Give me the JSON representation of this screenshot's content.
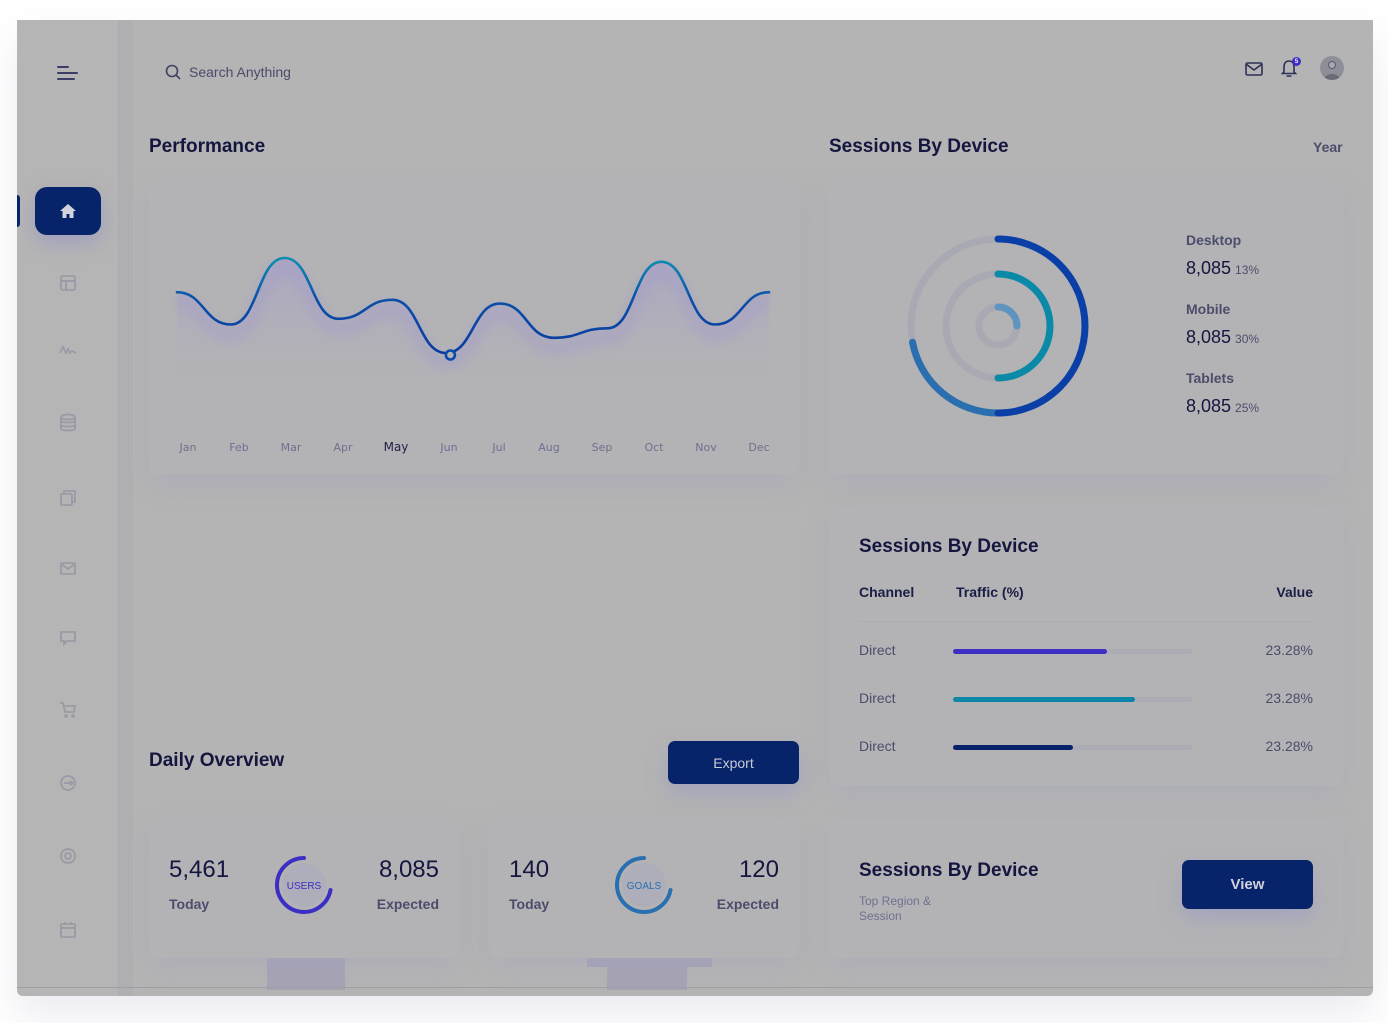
{
  "header": {
    "search_placeholder": "Search Anything",
    "notification_count": "5"
  },
  "sidebar": {
    "items": [
      {
        "name": "home",
        "icon": "home-icon",
        "active": true
      },
      {
        "name": "layout",
        "icon": "layout-icon"
      },
      {
        "name": "activity",
        "icon": "activity-icon"
      },
      {
        "name": "database",
        "icon": "database-icon"
      },
      {
        "name": "copy",
        "icon": "copy-icon"
      },
      {
        "name": "mail",
        "icon": "mail-icon"
      },
      {
        "name": "chat",
        "icon": "chat-icon"
      },
      {
        "name": "cart",
        "icon": "cart-icon"
      },
      {
        "name": "toggle",
        "icon": "toggle-icon"
      },
      {
        "name": "target",
        "icon": "target-icon"
      },
      {
        "name": "calendar",
        "icon": "calendar-icon"
      }
    ]
  },
  "performance": {
    "title": "Performance",
    "active_month": "May",
    "highlighted_point": "Jun-Jul"
  },
  "sessions": {
    "title": "Sessions By Device",
    "period": "Year",
    "devices": [
      {
        "label": "Desktop",
        "value": "8,085",
        "pct": "13%",
        "ring_fill": 0.5,
        "color": "#0a3fa8"
      },
      {
        "label": "Mobile",
        "value": "8,085",
        "pct": "30%",
        "ring_fill": 0.5,
        "color": "#0b8aa8"
      },
      {
        "label": "Tablets",
        "value": "8,085",
        "pct": "25%",
        "ring_fill": 0.25,
        "color": "#5f94c0"
      }
    ],
    "outer_ring_secondary": {
      "start": 0.5,
      "end": 0.72,
      "color": "#2a6fb0"
    }
  },
  "channels": {
    "title": "Sessions By Device",
    "headers": {
      "channel": "Channel",
      "traffic": "Traffic (%)",
      "value": "Value"
    },
    "rows": [
      {
        "channel": "Direct",
        "fill": 0.64,
        "value": "23.28%",
        "color": "#3f2ec2"
      },
      {
        "channel": "Direct",
        "fill": 0.76,
        "value": "23.28%",
        "color": "#0b86a6"
      },
      {
        "channel": "Direct",
        "fill": 0.5,
        "value": "23.28%",
        "color": "#07226a"
      }
    ]
  },
  "daily": {
    "title": "Daily Overview",
    "export_label": "Export",
    "stats": [
      {
        "today": "5,461",
        "today_label": "Today",
        "expected": "8,085",
        "expected_label": "Expected",
        "ring_label": "USERS",
        "ring_fill": 0.72,
        "color": "#3b2ec4"
      },
      {
        "today": "140",
        "today_label": "Today",
        "expected": "120",
        "expected_label": "Expected",
        "ring_label": "GOALS",
        "ring_fill": 0.72,
        "color": "#2870b0"
      }
    ]
  },
  "region": {
    "title": "Sessions By Device",
    "subtitle": "Top Region & Session",
    "view_label": "View"
  },
  "chart_data": {
    "type": "line",
    "title": "Performance",
    "categories": [
      "Jan",
      "Feb",
      "Mar",
      "Apr",
      "May",
      "Jun",
      "Jul",
      "Aug",
      "Sep",
      "Oct",
      "Nov",
      "Dec"
    ],
    "series": [
      {
        "name": "Performance",
        "values": [
          62,
          45,
          80,
          48,
          58,
          30,
          56,
          38,
          43,
          78,
          45,
          62
        ]
      }
    ],
    "ylim": [
      0,
      100
    ],
    "grid": false,
    "xlabel": "",
    "ylabel": ""
  }
}
